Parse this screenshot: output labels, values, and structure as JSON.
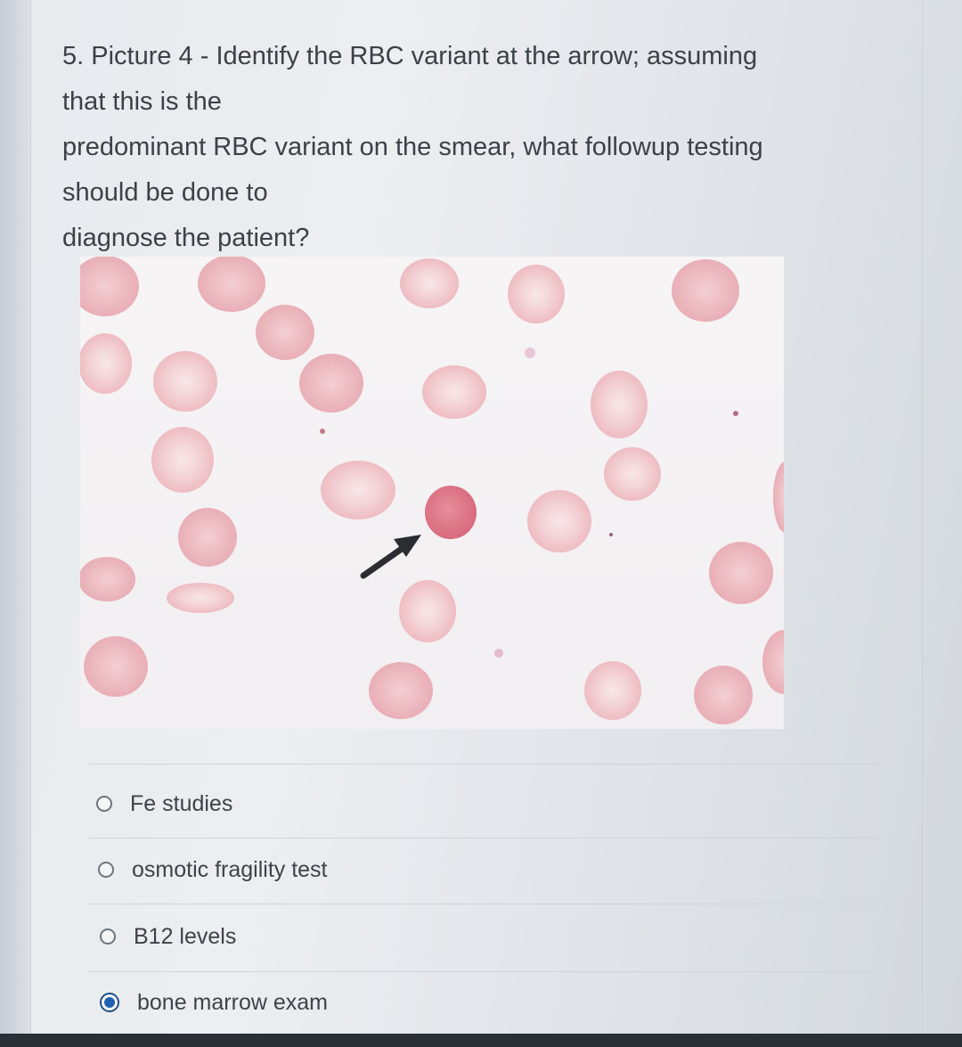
{
  "question": {
    "lines": [
      "5. Picture 4 - Identify the RBC variant at the arrow; assuming",
      "that this is the",
      "predominant RBC variant on the smear, what followup testing",
      "should be done to",
      "diagnose the patient?"
    ]
  },
  "options": [
    {
      "label": "Fe studies",
      "selected": false
    },
    {
      "label": "osmotic fragility test",
      "selected": false
    },
    {
      "label": "B12 levels",
      "selected": false
    },
    {
      "label": "bone marrow exam",
      "selected": true
    }
  ],
  "colors": {
    "rbc_pale": "#f0c7cb",
    "rbc_center": "#f7e3e5",
    "spherocyte": "#e07d8d",
    "arrow": "#2b2d33",
    "selected_radio": "#1f62b4"
  }
}
